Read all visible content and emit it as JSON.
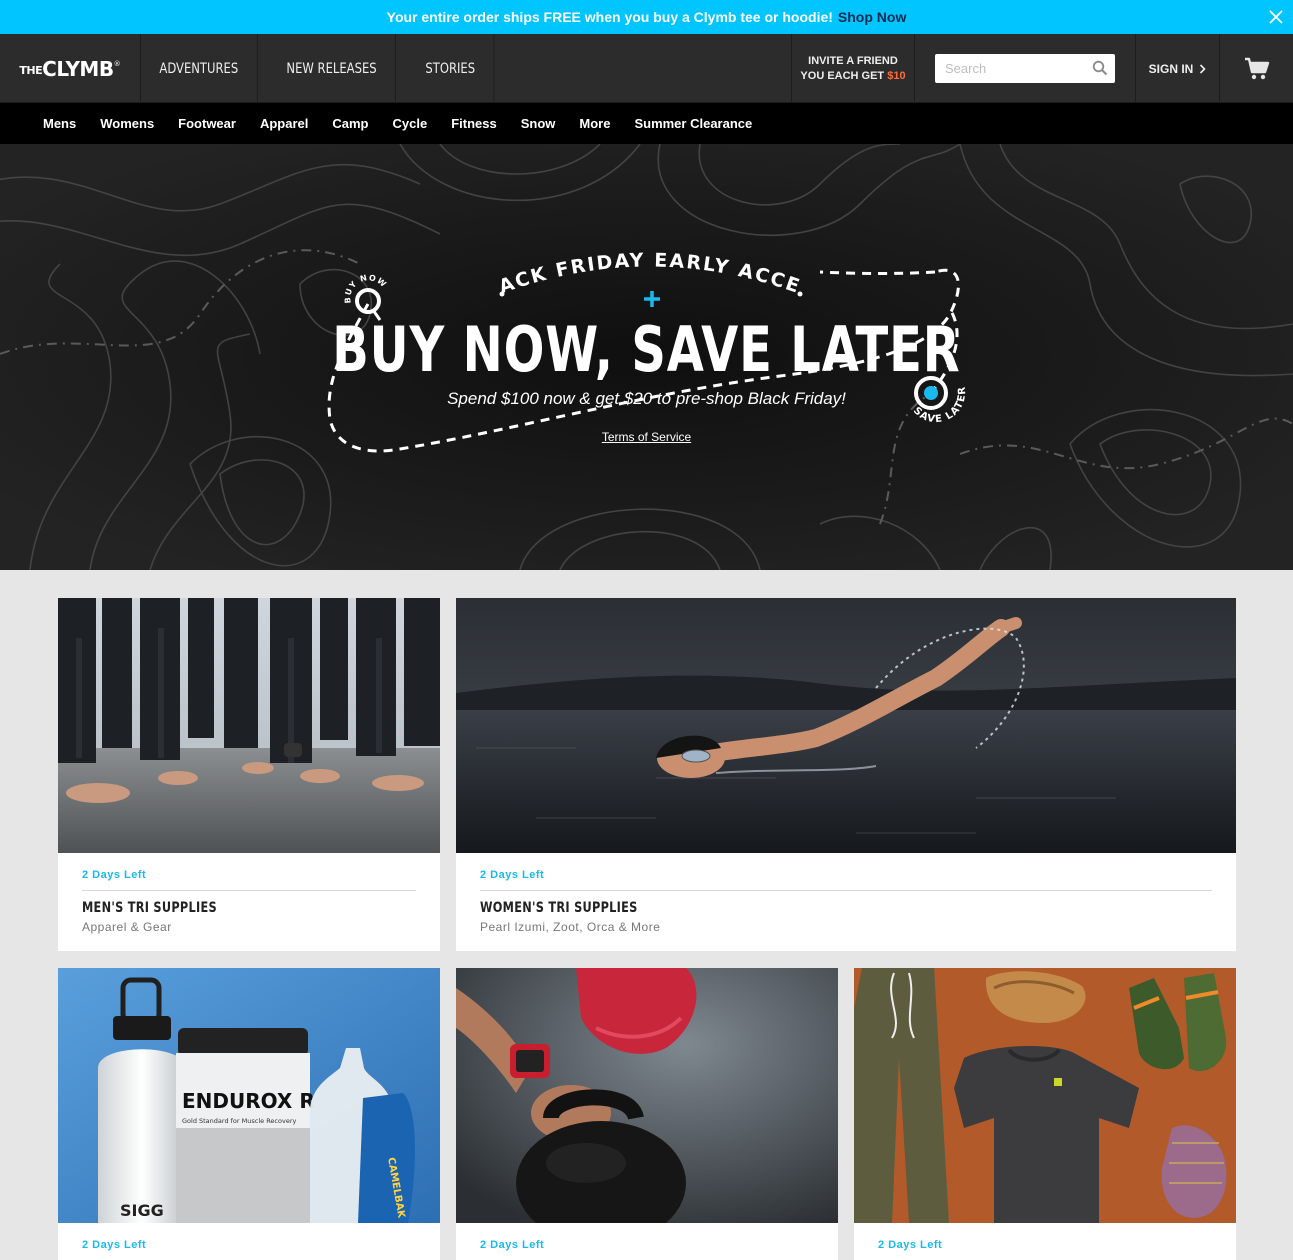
{
  "promo": {
    "text": "Your entire order ships FREE when you buy a Clymb tee or hoodie!",
    "link": "Shop Now"
  },
  "header": {
    "logo_prefix": "THE",
    "logo_brand": "CLYMB",
    "logo_mark": "®",
    "nav": [
      "ADVENTURES",
      "NEW RELEASES",
      "STORIES"
    ],
    "invite_line1": "INVITE A FRIEND",
    "invite_line2": "YOU EACH GET",
    "invite_amount": "$10",
    "search_placeholder": "Search",
    "signin": "SIGN IN"
  },
  "categories": [
    "Mens",
    "Womens",
    "Footwear",
    "Apparel",
    "Camp",
    "Cycle",
    "Fitness",
    "Snow",
    "More",
    "Summer Clearance"
  ],
  "hero": {
    "eyebrow": "BLACK FRIDAY EARLY ACCESS",
    "headline": "BUY NOW, SAVE LATER",
    "subline": "Spend $100 now & get $20 to pre-shop Black Friday!",
    "tos": "Terms of Service",
    "start_label": "BUY NOW",
    "end_label": "SAVE LATER"
  },
  "cards": [
    {
      "days": "2 Days Left",
      "title": "MEN'S TRI SUPPLIES",
      "subtitle": "Apparel & Gear"
    },
    {
      "days": "2 Days Left",
      "title": "WOMEN'S TRI SUPPLIES",
      "subtitle": "Pearl Izumi, Zoot, Orca & More"
    },
    {
      "days": "2 Days Left",
      "title": "",
      "subtitle": ""
    },
    {
      "days": "2 Days Left",
      "title": "",
      "subtitle": ""
    },
    {
      "days": "2 Days Left",
      "title": "",
      "subtitle": ""
    }
  ],
  "image_text": {
    "bottle_brand": "SIGG",
    "tub_brand": "ENDUROX R",
    "tub_tagline": "Gold Standard for Muscle Recovery",
    "flask_brand": "CAMELBAK"
  },
  "colors": {
    "promo_bg": "#00c5ff",
    "accent": "#1ab8ec",
    "invite_amount": "#ff6b3d",
    "header_bg": "#2c2c2c"
  }
}
